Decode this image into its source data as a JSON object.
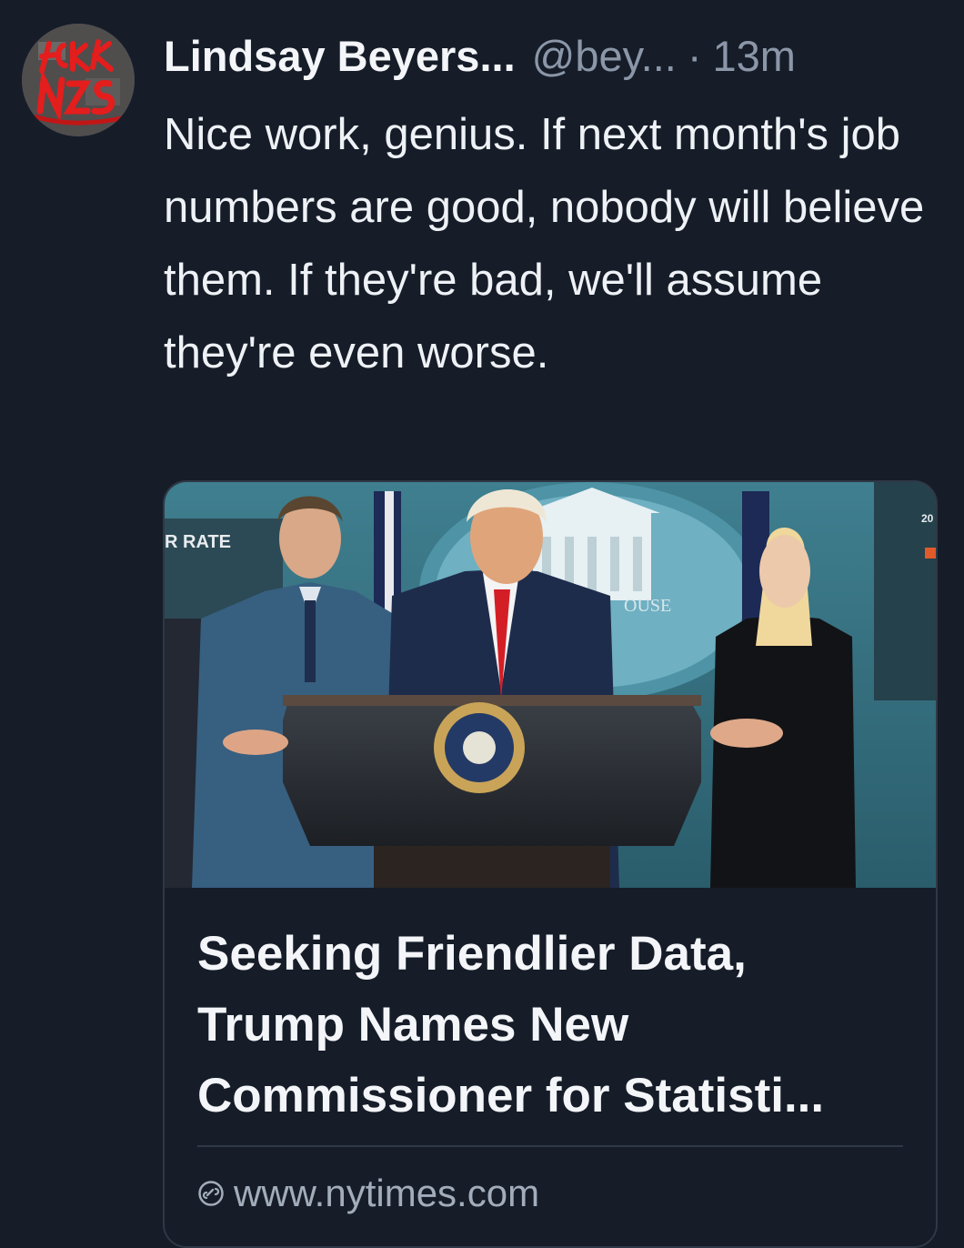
{
  "post": {
    "author_display_name": "Lindsay Beyers...",
    "author_handle": "@bey...",
    "separator": "·",
    "timestamp": "13m",
    "avatar_text": "FCK NZS",
    "text": "Nice work, genius. If next month's job numbers are good, nobody will believe them. If they're bad, we'll assume they're even worse."
  },
  "link_card": {
    "title": "Seeking Friendlier Data, Trump Names New Commissioner for Statisti...",
    "domain": "www.nytimes.com",
    "domain_icon": "link-icon",
    "image_text": {
      "wall_sign": "R RATE",
      "backdrop_text": "OUSE",
      "screen_text": "20"
    }
  },
  "colors": {
    "background": "#161d29",
    "text_primary": "#eef1f5",
    "text_secondary": "#8b97a8",
    "card_border": "#2f3846"
  }
}
